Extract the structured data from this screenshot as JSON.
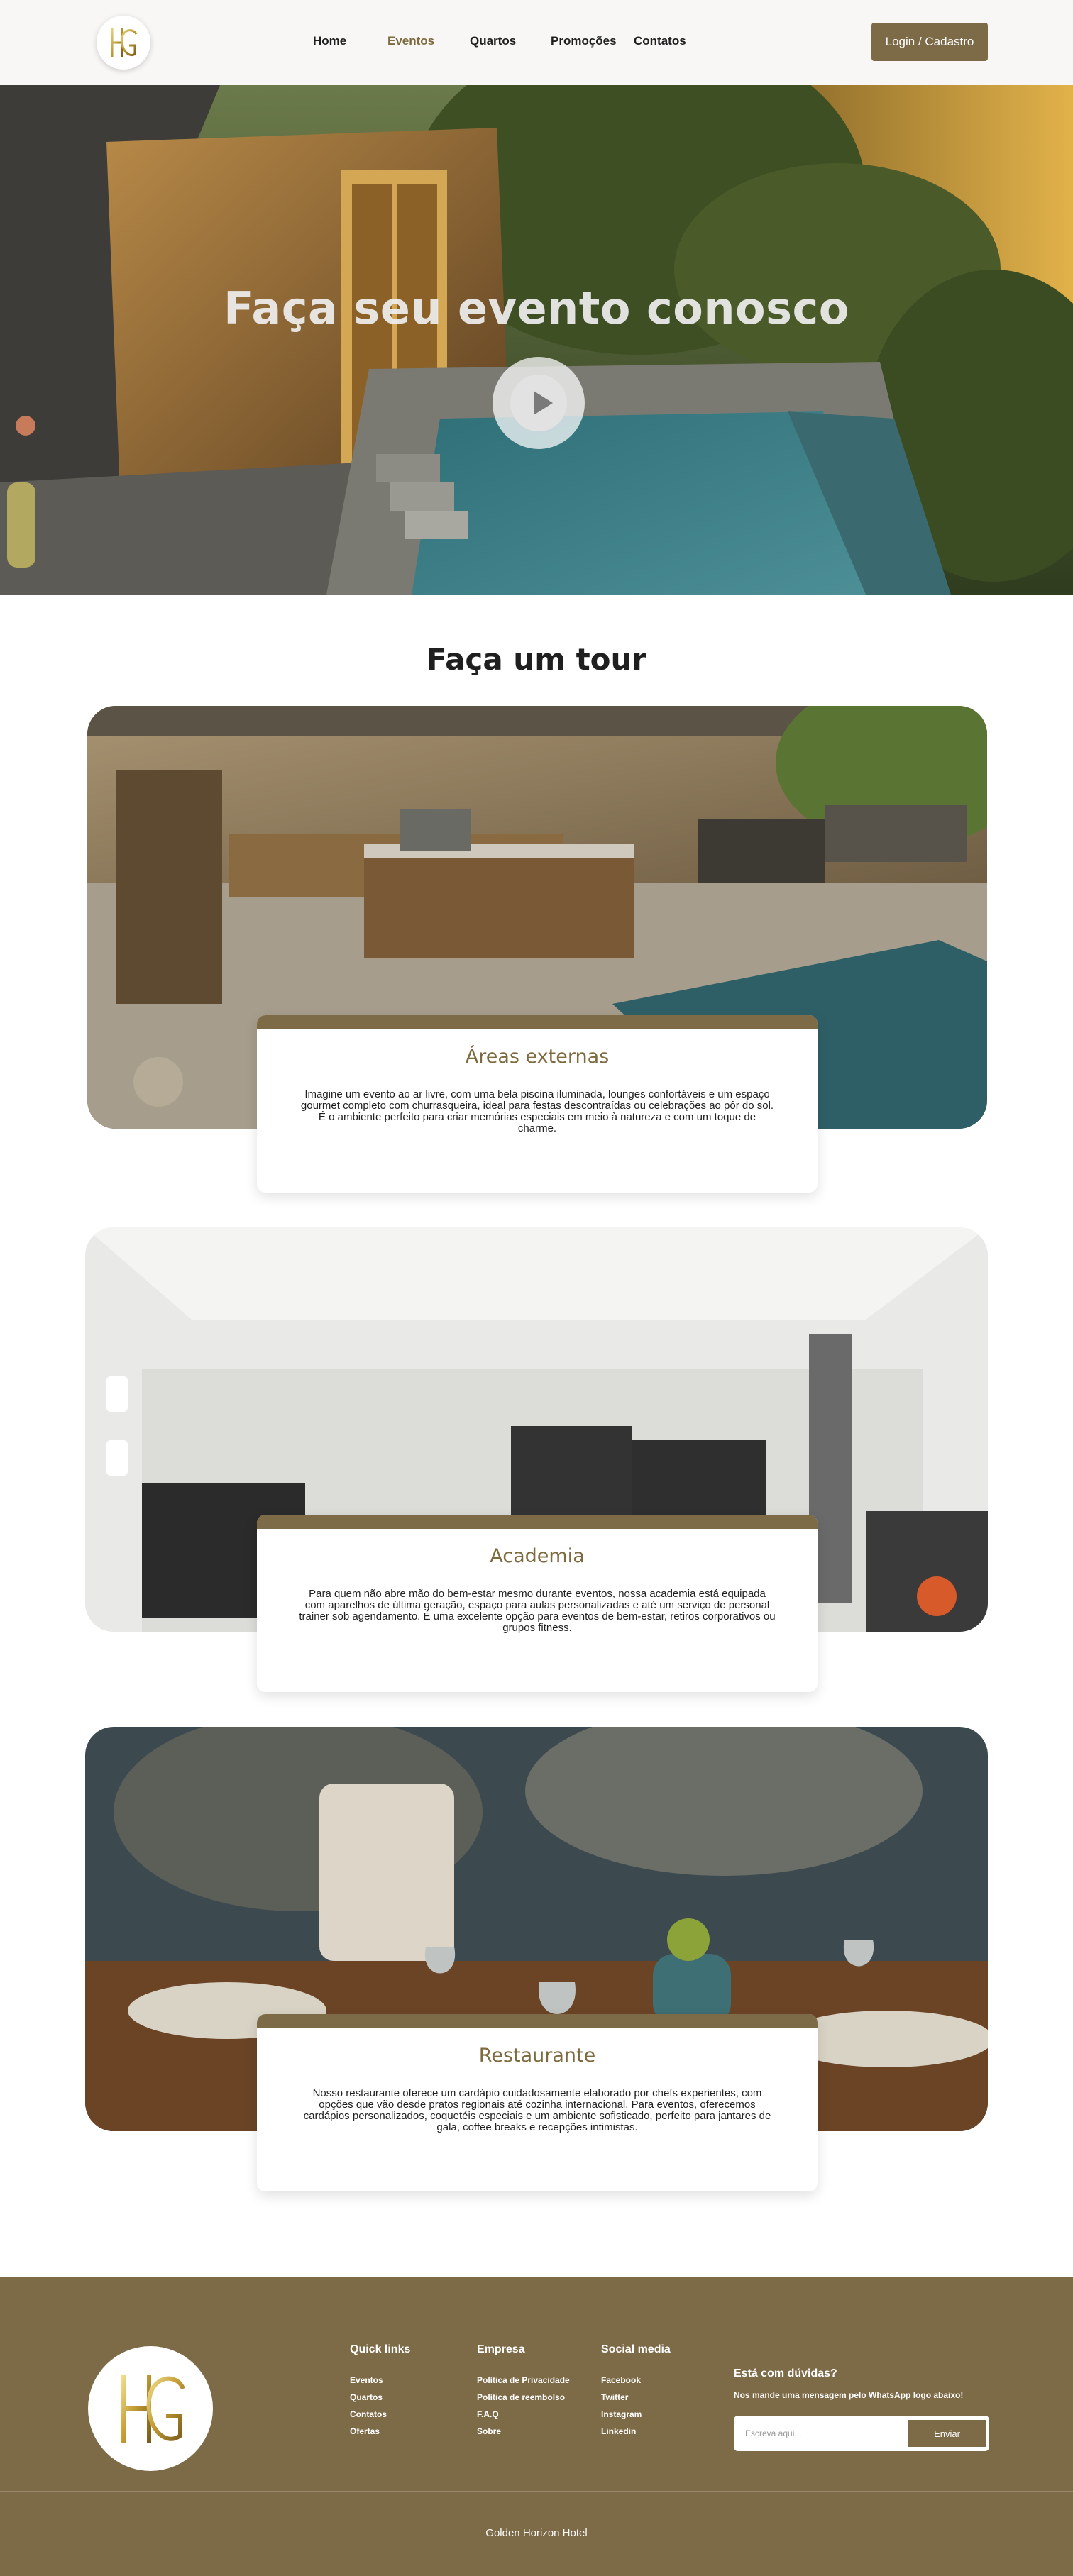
{
  "header": {
    "logo_text": "HG",
    "nav": [
      {
        "label": "Home"
      },
      {
        "label": "Eventos"
      },
      {
        "label": "Quartos"
      },
      {
        "label": "Promoções"
      },
      {
        "label": "Contatos"
      }
    ],
    "login_label": "Login / Cadastro",
    "active_nav": "Eventos"
  },
  "hero": {
    "title": "Faça seu evento conosco",
    "play_icon": "play-icon"
  },
  "tour": {
    "title": "Faça um tour",
    "cards": [
      {
        "title": "Áreas externas",
        "text": "Imagine um evento ao ar livre, com uma bela piscina iluminada, lounges confortáveis e um espaço gourmet completo com churrasqueira, ideal para festas descontraídas ou celebrações ao pôr do sol. É o ambiente perfeito para criar memórias especiais em meio à natureza e com um toque de charme."
      },
      {
        "title": "Academia",
        "text": "Para quem não abre mão do bem-estar mesmo durante eventos, nossa academia está equipada com aparelhos de última geração, espaço para aulas personalizadas e até um serviço de personal trainer sob agendamento. É uma excelente opção para eventos de bem-estar, retiros corporativos ou grupos fitness."
      },
      {
        "title": "Restaurante",
        "text": "Nosso restaurante oferece um cardápio cuidadosamente elaborado por chefs experientes, com opções que vão desde pratos regionais até cozinha internacional. Para eventos, oferecemos cardápios personalizados, coquetéis especiais e um ambiente sofisticado, perfeito para jantares de gala, coffee breaks e recepções intimistas."
      }
    ]
  },
  "footer": {
    "logo_text": "HG",
    "quick_links": {
      "title": "Quick links",
      "items": [
        "Eventos",
        "Quartos",
        "Contatos",
        "Ofertas"
      ]
    },
    "empresa": {
      "title": "Empresa",
      "items": [
        "Política de Privacidade",
        "Política de reembolso",
        "F.A.Q",
        "Sobre"
      ]
    },
    "social": {
      "title": "Social media",
      "items": [
        "Facebook",
        "Twitter",
        "Instagram",
        "Linkedin"
      ]
    },
    "contact": {
      "title": "Está com dúvidas?",
      "subtitle": "Nos mande uma mensagem pelo WhatsApp logo abaixo!",
      "placeholder": "Escreva aqui...",
      "send_label": "Enviar"
    },
    "copyright": "Golden Horizon Hotel"
  },
  "colors": {
    "brand": "#7d6a47",
    "brand_text": "#7d6a3e",
    "header_bg": "#f8f7f5",
    "white": "#ffffff"
  }
}
